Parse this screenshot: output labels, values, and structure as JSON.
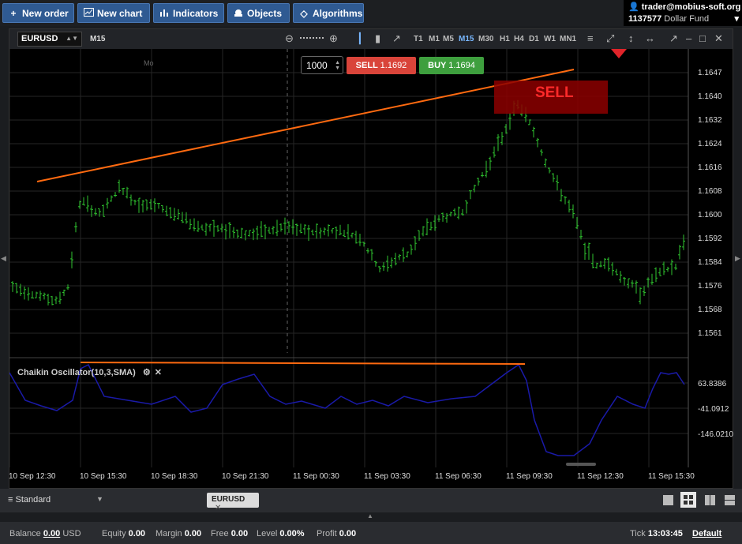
{
  "toolbar": {
    "new_order": "New order",
    "new_chart": "New chart",
    "indicators": "Indicators",
    "objects": "Objects",
    "algorithms": "Algorithms"
  },
  "account": {
    "user": "trader@mobius-soft.org",
    "id": "1137577",
    "fund": "Dollar Fund"
  },
  "chart": {
    "symbol": "EURUSD",
    "timeframe": "M15",
    "timeframes": [
      "T1",
      "M1",
      "M5",
      "M15",
      "M30",
      "H1",
      "H4",
      "D1",
      "W1",
      "MN1"
    ],
    "active_timeframe": "M15",
    "day_marker": "Mo",
    "quantity": "1000",
    "sell_label": "SELL",
    "sell_price": "1.1692",
    "buy_label": "BUY",
    "buy_price": "1.1694",
    "signal_label": "SELL",
    "price_labels": [
      "1.1647",
      "1.1640",
      "1.1632",
      "1.1624",
      "1.1616",
      "1.1608",
      "1.1600",
      "1.1592",
      "1.1584",
      "1.1576",
      "1.1568",
      "1.1561"
    ],
    "time_labels": [
      "10 Sep 12:30",
      "10 Sep 15:30",
      "10 Sep 18:30",
      "10 Sep 21:30",
      "11 Sep 00:30",
      "11 Sep 03:30",
      "11 Sep 06:30",
      "11 Sep 09:30",
      "11 Sep 12:30",
      "11 Sep 15:30"
    ],
    "oscillator_label": "Chaikin Oscillator(10,3,SMA)",
    "oscillator_levels": [
      "63.8386",
      "-41.0912",
      "-146.0210"
    ],
    "colors": {
      "up": "#2fc52f",
      "down": "#2fc52f",
      "trendline": "#ff6a10",
      "oscillator": "#1a1aa8",
      "sell": "#d9443a",
      "buy": "#3e9f3e"
    }
  },
  "tabs": {
    "layout": "Standard",
    "open_tab": "EURUSD"
  },
  "status": {
    "balance_label": "Balance",
    "balance_value": "0.00",
    "balance_ccy": "USD",
    "equity_label": "Equity",
    "equity_value": "0.00",
    "margin_label": "Margin",
    "margin_value": "0.00",
    "free_label": "Free",
    "free_value": "0.00",
    "level_label": "Level",
    "level_value": "0.00%",
    "profit_label": "Profit",
    "profit_value": "0.00",
    "tick_label": "Tick",
    "tick_value": "13:03:45",
    "tick_mode": "Default"
  },
  "icons": [
    "plus-icon",
    "chart-icon",
    "bars-icon",
    "objects-icon",
    "diamond-icon",
    "user-icon",
    "candle-icon"
  ]
}
